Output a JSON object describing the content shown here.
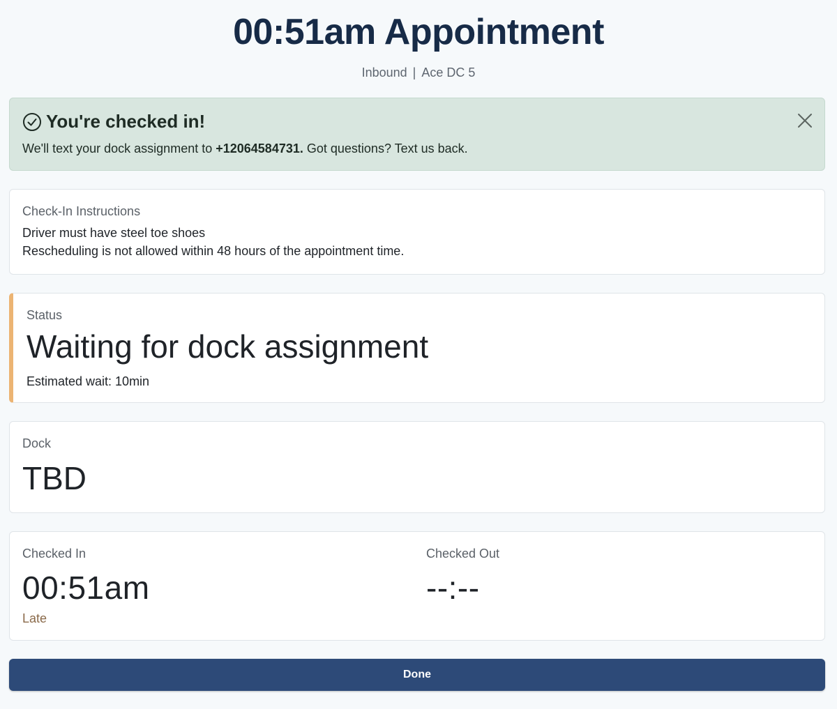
{
  "header": {
    "title": "00:51am Appointment",
    "direction": "Inbound",
    "separator": "|",
    "location": "Ace DC 5"
  },
  "alert": {
    "icon": "check-circle-icon",
    "title": "You're checked in!",
    "message_prefix": "We'll text your dock assignment to ",
    "phone": "+12064584731.",
    "message_suffix": " Got questions? Text us back.",
    "close_icon": "close-icon",
    "background_color": "#d8e6df"
  },
  "instructions": {
    "label": "Check-In Instructions",
    "lines": [
      "Driver must have steel toe shoes",
      "Rescheduling is not allowed within 48 hours of the appointment time."
    ]
  },
  "status": {
    "label": "Status",
    "value": "Waiting for dock assignment",
    "estimate": "Estimated wait: 10min",
    "accent_color": "#ecb473"
  },
  "dock": {
    "label": "Dock",
    "value": "TBD"
  },
  "times": {
    "checked_in_label": "Checked In",
    "checked_in_value": "00:51am",
    "checked_in_note": "Late",
    "checked_out_label": "Checked Out",
    "checked_out_value": "--:--"
  },
  "actions": {
    "done_label": "Done",
    "button_color": "#2d4a78"
  }
}
